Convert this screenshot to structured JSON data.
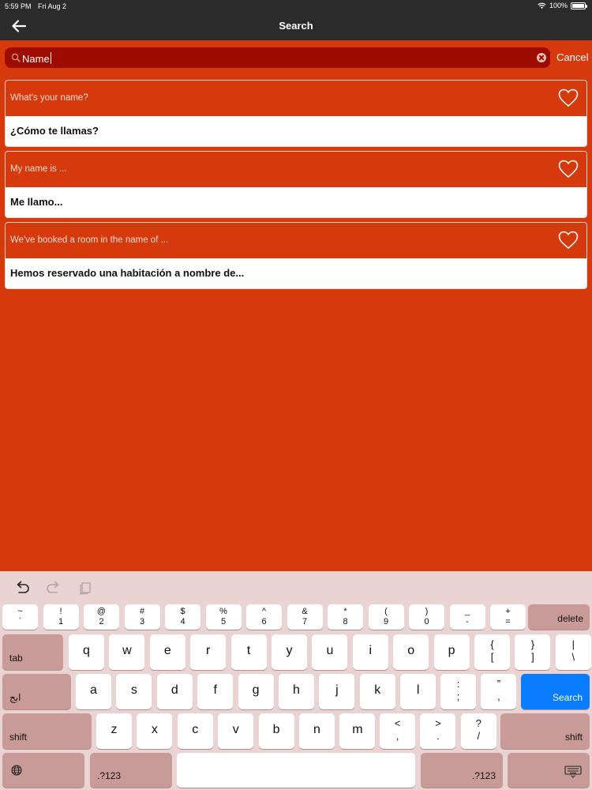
{
  "status": {
    "time": "5:59 PM",
    "date": "Fri Aug 2",
    "battery": "100%"
  },
  "nav": {
    "title": "Search",
    "back_icon": "arrow-left-icon"
  },
  "search": {
    "query": "Name",
    "cancel_label": "Cancel"
  },
  "results": [
    {
      "english": "What's your name?",
      "spanish": "¿Cómo te llamas?",
      "favorite": false
    },
    {
      "english": "My name is ...",
      "spanish": "Me llamo...",
      "favorite": false
    },
    {
      "english": "We've booked a room in the name of ...",
      "spanish": "Hemos reservado una habitación a nombre de...",
      "favorite": false
    }
  ],
  "keyboard": {
    "toolbar": [
      "undo-icon",
      "redo-icon",
      "paste-icon"
    ],
    "number_row": [
      {
        "top": "~",
        "bottom": "`"
      },
      {
        "top": "!",
        "bottom": "1"
      },
      {
        "top": "@",
        "bottom": "2"
      },
      {
        "top": "#",
        "bottom": "3"
      },
      {
        "top": "$",
        "bottom": "4"
      },
      {
        "top": "%",
        "bottom": "5"
      },
      {
        "top": "^",
        "bottom": "6"
      },
      {
        "top": "&",
        "bottom": "7"
      },
      {
        "top": "*",
        "bottom": "8"
      },
      {
        "top": "(",
        "bottom": "9"
      },
      {
        "top": ")",
        "bottom": "0"
      },
      {
        "top": "_",
        "bottom": "-"
      },
      {
        "top": "+",
        "bottom": "="
      }
    ],
    "delete_label": "delete",
    "tab_label": "tab",
    "row_q": [
      "q",
      "w",
      "e",
      "r",
      "t",
      "y",
      "u",
      "i",
      "o",
      "p"
    ],
    "row_q_punct": [
      {
        "top": "{",
        "bottom": "["
      },
      {
        "top": "}",
        "bottom": "]"
      },
      {
        "top": "|",
        "bottom": "\\"
      }
    ],
    "lang_label": "ابج",
    "row_a": [
      "a",
      "s",
      "d",
      "f",
      "g",
      "h",
      "j",
      "k",
      "l"
    ],
    "row_a_punct": [
      {
        "top": ":",
        "bottom": ";"
      },
      {
        "top": "”",
        "bottom": ","
      }
    ],
    "search_label": "Search",
    "shift_label": "shift",
    "row_z": [
      "z",
      "x",
      "c",
      "v",
      "b",
      "n",
      "m"
    ],
    "row_z_punct": [
      {
        "top": "<",
        "bottom": ","
      },
      {
        "top": ">",
        "bottom": "."
      },
      {
        "top": "?",
        "bottom": "/"
      }
    ],
    "numbers_label": ".?123",
    "colors": {
      "keys": "#ffffff",
      "modifier": "#c99b98",
      "action": "#0a7cff",
      "background": "#ead4d3"
    }
  },
  "colors": {
    "accent": "#d63a0c",
    "nav": "#2b2b2b",
    "search_field": "#9e0c00"
  }
}
